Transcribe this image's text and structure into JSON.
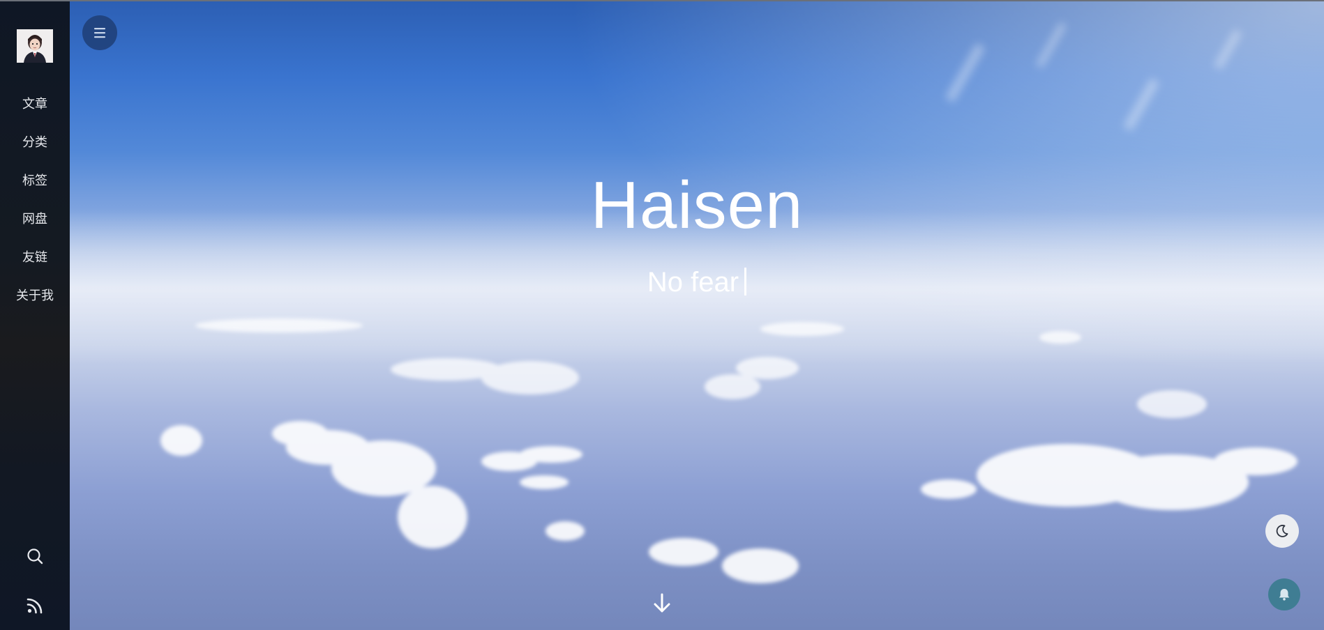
{
  "sidebar": {
    "avatar_alt": "avatar",
    "items": [
      {
        "label": "文章"
      },
      {
        "label": "分类"
      },
      {
        "label": "标签"
      },
      {
        "label": "网盘"
      },
      {
        "label": "友链"
      },
      {
        "label": "关于我"
      }
    ],
    "bottom_icons": [
      "search-icon",
      "rss-icon"
    ]
  },
  "hero": {
    "title": "Haisen",
    "subtitle": "No fear",
    "menu_icon": "hamburger-menu-icon",
    "scroll_icon": "arrow-down-icon"
  },
  "floating": {
    "theme_icon": "moon-icon",
    "notify_icon": "bell-icon"
  },
  "colors": {
    "sidebar_bg": "#0f1725",
    "sky_top": "#2c5fb4",
    "menu_button": "#1e3e76",
    "bell_button": "#3f7d93",
    "theme_button": "#eceef1"
  }
}
